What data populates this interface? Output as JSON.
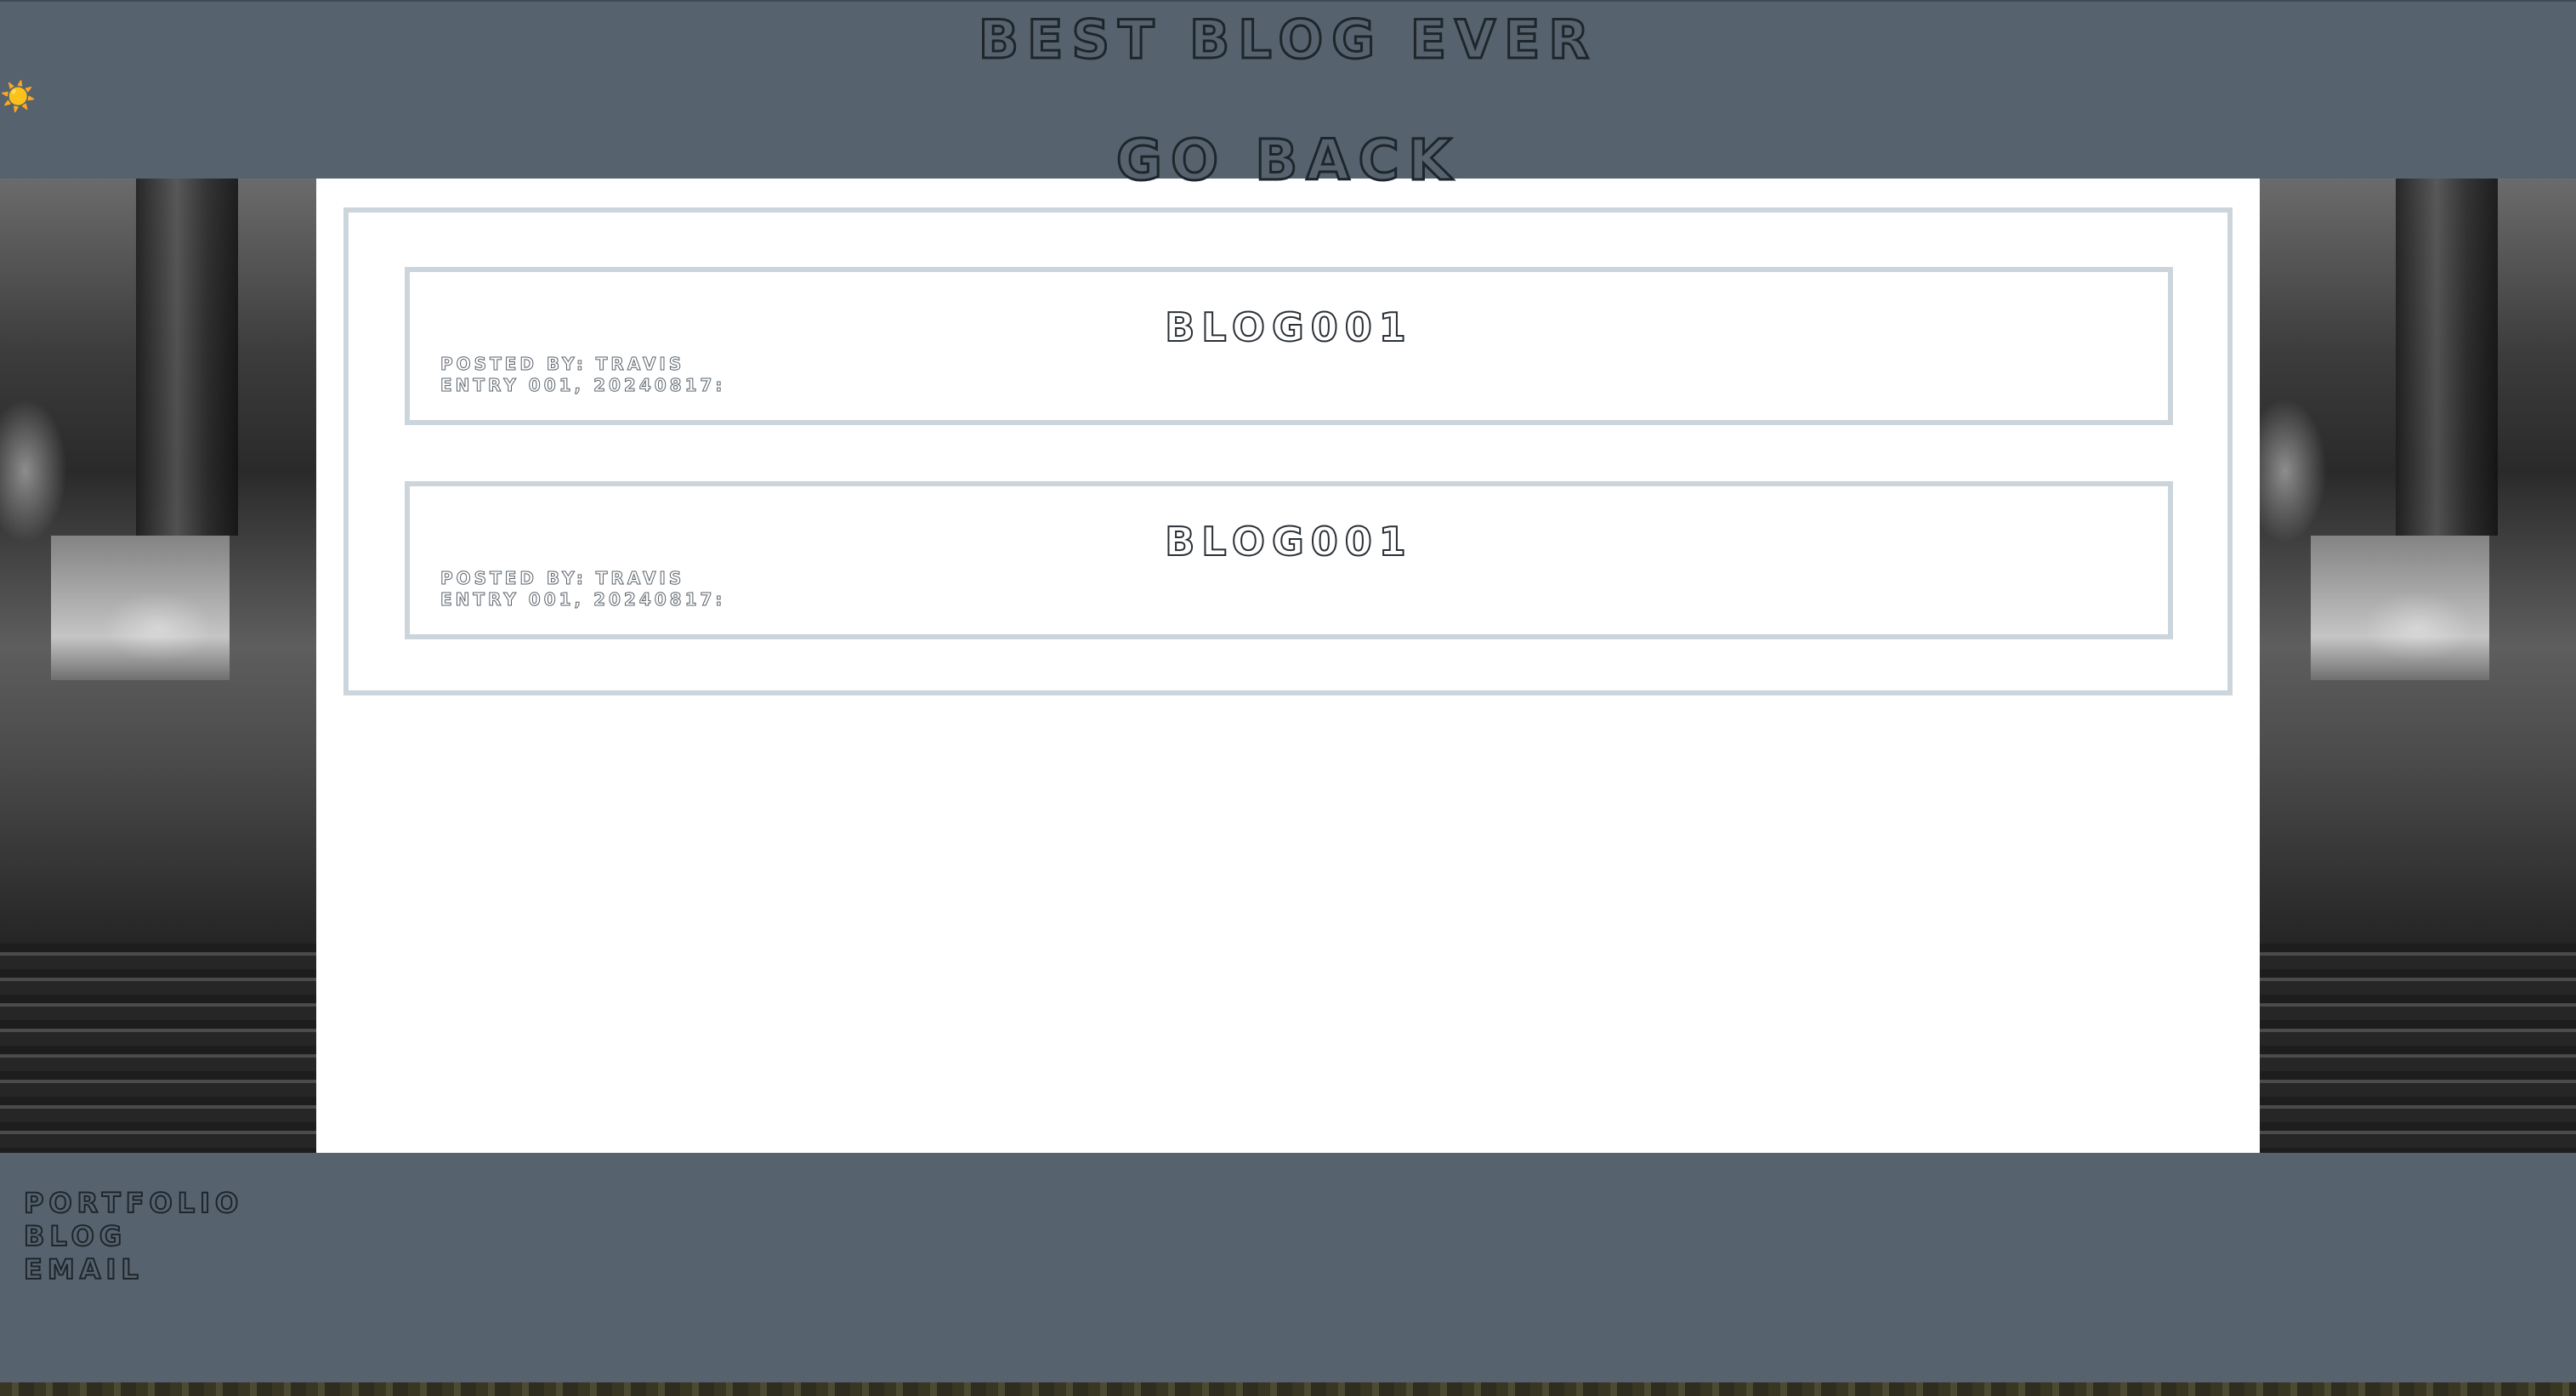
{
  "header": {
    "site_title": "Best Blog Ever",
    "theme_toggle_icon": "☀️",
    "go_back_label": "Go Back"
  },
  "posts": [
    {
      "title": "Blog001",
      "author_line": "Posted by: Travis",
      "entry_line": "Entry 001, 20240817:"
    },
    {
      "title": "Blog001",
      "author_line": "Posted by: Travis",
      "entry_line": "Entry 001, 20240817:"
    }
  ],
  "footer": {
    "links": [
      "Portfolio",
      "Blog",
      "Email"
    ]
  },
  "colors": {
    "header_footer_bg": "#56636e",
    "card_border": "#cdd5dc",
    "content_bg": "#ffffff"
  }
}
